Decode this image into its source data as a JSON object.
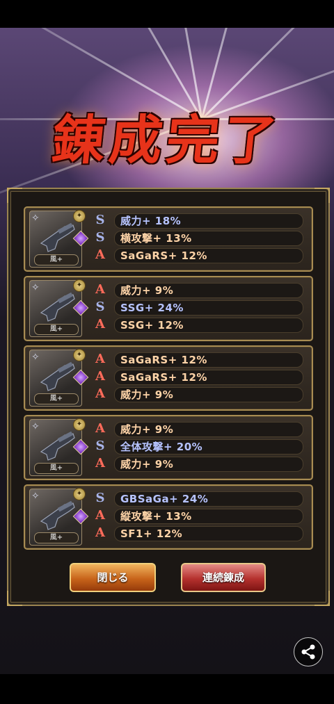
{
  "banner": {
    "title": "錬成完了"
  },
  "results": [
    {
      "element_tag": "風+",
      "stats": [
        {
          "icon": "S",
          "color": "blue",
          "text": "威力+ 18%"
        },
        {
          "icon": "S",
          "color": "orange",
          "text": "横攻撃+ 13%"
        },
        {
          "icon": "A",
          "color": "orange",
          "text": "SaGaRS+ 12%"
        }
      ]
    },
    {
      "element_tag": "風+",
      "stats": [
        {
          "icon": "A",
          "color": "orange",
          "text": "威力+ 9%"
        },
        {
          "icon": "S",
          "color": "blue",
          "text": "SSG+ 24%"
        },
        {
          "icon": "A",
          "color": "orange",
          "text": "SSG+ 12%"
        }
      ]
    },
    {
      "element_tag": "風+",
      "stats": [
        {
          "icon": "A",
          "color": "orange",
          "text": "SaGaRS+ 12%"
        },
        {
          "icon": "A",
          "color": "orange",
          "text": "SaGaRS+ 12%"
        },
        {
          "icon": "A",
          "color": "orange",
          "text": "威力+ 9%"
        }
      ]
    },
    {
      "element_tag": "風+",
      "stats": [
        {
          "icon": "A",
          "color": "orange",
          "text": "威力+ 9%"
        },
        {
          "icon": "S",
          "color": "blue",
          "text": "全体攻撃+ 20%"
        },
        {
          "icon": "A",
          "color": "orange",
          "text": "威力+ 9%"
        }
      ]
    },
    {
      "element_tag": "風+",
      "stats": [
        {
          "icon": "S",
          "color": "blue",
          "text": "GBSaGa+ 24%"
        },
        {
          "icon": "A",
          "color": "orange",
          "text": "縦攻撃+ 13%"
        },
        {
          "icon": "A",
          "color": "orange",
          "text": "SF1+ 12%"
        }
      ]
    }
  ],
  "buttons": {
    "close_label": "閉じる",
    "continue_label": "連続錬成"
  },
  "colors": {
    "blue_stat": "#b6c3ff",
    "orange_stat": "#ffd4a8",
    "title_red": "#e7331a",
    "frame_gold": "#a88c52"
  },
  "icons": {
    "share": "share-icon",
    "gun": "pistol-icon",
    "stat_s": "s-rank-icon",
    "stat_a": "a-rank-icon"
  }
}
